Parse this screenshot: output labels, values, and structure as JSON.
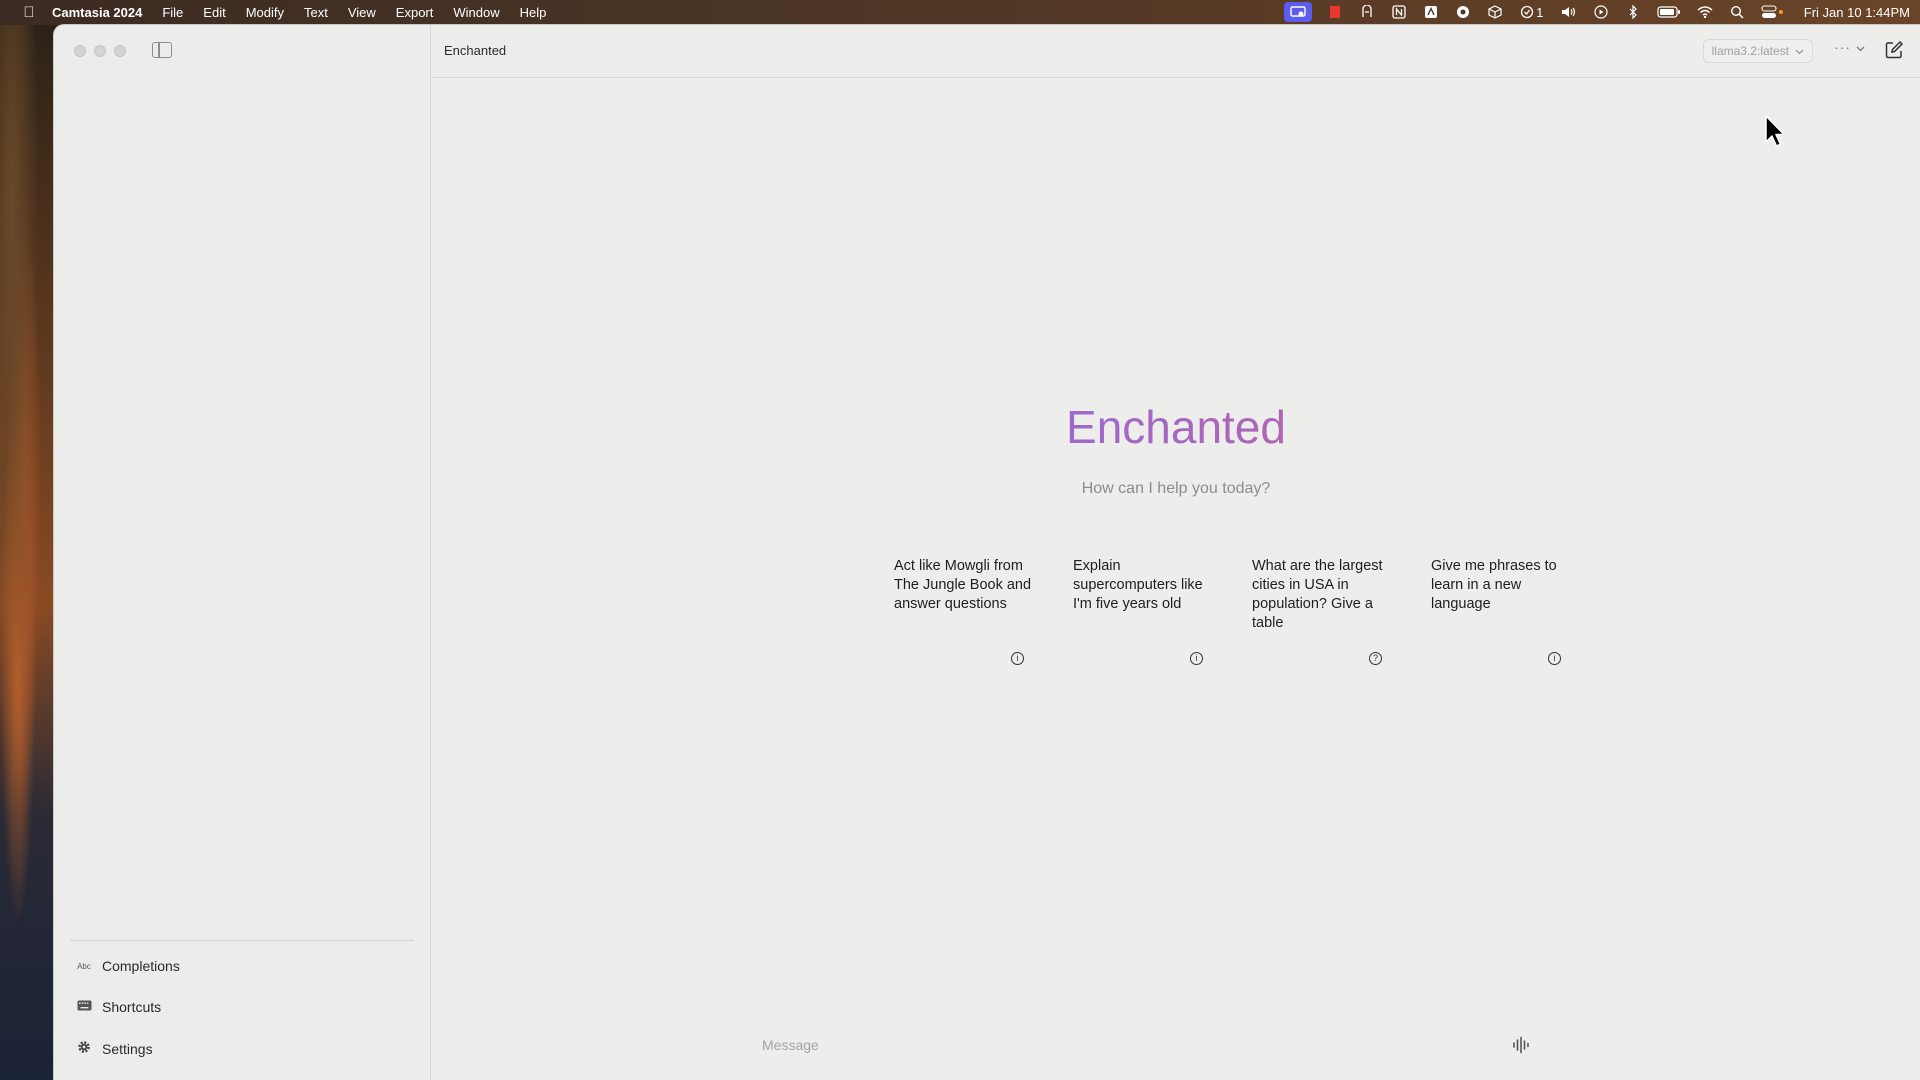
{
  "menubar": {
    "app_name": "Camtasia 2024",
    "menus": [
      "File",
      "Edit",
      "Modify",
      "Text",
      "View",
      "Export",
      "Window",
      "Help"
    ],
    "status_icons": [
      "camtasia-recorder-icon",
      "record-icon",
      "reader-icon",
      "notion-icon",
      "text-icon",
      "circle-app-icon",
      "box-icon",
      "checkmark-count-icon",
      "volume-icon",
      "play-icon",
      "bluetooth-icon",
      "battery-icon",
      "wifi-icon",
      "search-icon",
      "control-center-icon"
    ],
    "checkmark_count": "1",
    "clock": "Fri Jan 10  1:44PM"
  },
  "window": {
    "title": "Enchanted",
    "model": "llama3.2:latest"
  },
  "sidebar": {
    "items": [
      {
        "label": "Completions",
        "icon": "abc-icon"
      },
      {
        "label": "Shortcuts",
        "icon": "keyboard-icon"
      },
      {
        "label": "Settings",
        "icon": "gear-icon"
      }
    ],
    "abc_glyph": "Abc"
  },
  "hero": {
    "title": "Enchanted",
    "subtitle": "How can I help you today?"
  },
  "suggestions": [
    {
      "text": "Act like Mowgli from The Jungle Book and answer questions",
      "icon": "info-icon"
    },
    {
      "text": "Explain supercomputers like I'm five years old",
      "icon": "info-icon"
    },
    {
      "text": "What are the largest cities in USA in population? Give a table",
      "icon": "question-icon"
    },
    {
      "text": "Give me phrases to learn in a new language",
      "icon": "info-icon"
    }
  ],
  "composer": {
    "placeholder": "Message"
  },
  "colors": {
    "title_gradient_start": "#6f7fe0",
    "title_gradient_end": "#e0566d",
    "window_bg": "#ececea"
  }
}
